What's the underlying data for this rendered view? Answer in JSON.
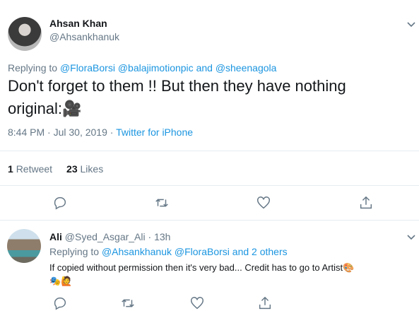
{
  "tweet": {
    "display_name": "Ahsan Khan",
    "handle": "@Ahsankhanuk",
    "replying_prefix": "Replying to",
    "replying_to": [
      "@FloraBorsi",
      "@balajimotionpic",
      "and",
      "@sheenagola"
    ],
    "text_line1": "Don't forget to them !! But then they have nothing",
    "text_line2": "original:",
    "text_emoji": "🎥",
    "time": "8:44 PM",
    "date": "Jul 30, 2019",
    "separator": "·",
    "source": "Twitter for iPhone",
    "retweets_count": "1",
    "retweets_label": "Retweet",
    "likes_count": "23",
    "likes_label": "Likes"
  },
  "reply": {
    "display_name": "Ali",
    "handle": "@Syed_Asgar_Ali",
    "separator": "·",
    "time_ago": "13h",
    "replying_prefix": "Replying to",
    "replying_to": [
      "@Ahsankhanuk",
      "@FloraBorsi",
      "and 2 others"
    ],
    "text": "If copied without permission then it's very bad... Credit has to go to Artist",
    "emojis": [
      "🎨",
      "🎭",
      "🙋"
    ]
  },
  "icons": {
    "chevron": "chevron-down-icon",
    "reply": "reply-icon",
    "retweet": "retweet-icon",
    "like": "heart-icon",
    "share": "share-icon"
  },
  "colors": {
    "link": "#1b95e0",
    "secondary_text": "#657786",
    "primary_text": "#14171a",
    "divider": "#e6ecf0"
  }
}
